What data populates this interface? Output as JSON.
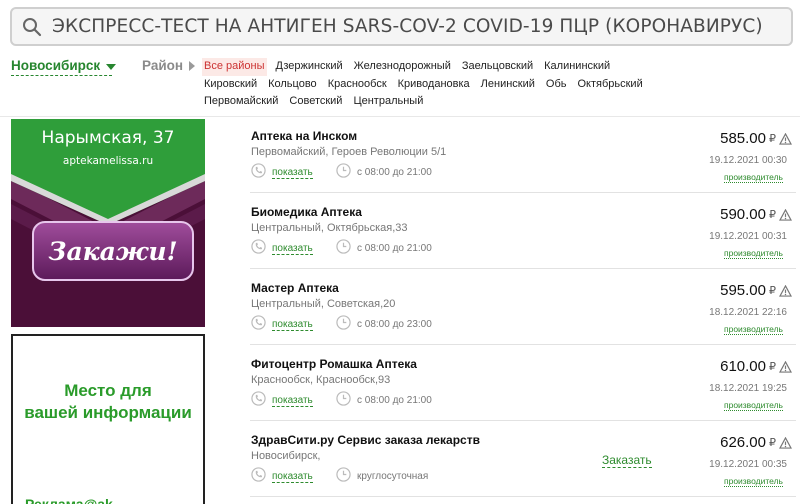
{
  "search": {
    "query": "ЭКСПРЕСС-ТЕСТ НА АНТИГЕН SARS-COV-2 COVID-19 ПЦР (КОРОНАВИРУС)",
    "icon": "search-icon"
  },
  "filters": {
    "city": "Новосибирск",
    "district_label": "Район",
    "districts": [
      "Все районы",
      "Дзержинский",
      "Железнодорожный",
      "Заельцовский",
      "Калининский",
      "Кировский",
      "Кольцово",
      "Краснообск",
      "Криводановка",
      "Ленинский",
      "Обь",
      "Октябрьский",
      "Первомайский",
      "Советский",
      "Центральный"
    ],
    "active_district": "Все районы"
  },
  "banners": {
    "pharmacy_ad": {
      "street": "Нарымская, 37",
      "site": "aptekamelissa.ru",
      "cta": "Закажи!"
    },
    "placeholder_ad": {
      "line1": "Место для",
      "line2": "вашей информации",
      "tail": "Реклама@ak"
    }
  },
  "listing": {
    "phone_label": "показать",
    "manufacturer_label": "производитель",
    "currency": "₽",
    "order_label": "Заказать",
    "items": [
      {
        "name": "Аптека на Инском",
        "address": "Первомайский, Героев Революции 5/1",
        "hours": "с 08:00 до 21:00",
        "price": "585.00",
        "date": "19.12.2021 00:30"
      },
      {
        "name": "Биомедика Аптека",
        "address": "Центральный, Октябрьская,33",
        "hours": "с 08:00 до 21:00",
        "price": "590.00",
        "date": "19.12.2021 00:31"
      },
      {
        "name": "Мастер Аптека",
        "address": "Центральный, Советская,20",
        "hours": "с 08:00 до 23:00",
        "price": "595.00",
        "date": "18.12.2021 22:16"
      },
      {
        "name": "Фитоцентр Ромашка Аптека",
        "address": "Краснообск, Краснообск,93",
        "hours": "с 08:00 до 21:00",
        "price": "610.00",
        "date": "18.12.2021 19:25"
      },
      {
        "name": "ЗдравСити.ру Сервис заказа лекарств",
        "address": "Новосибирск,",
        "hours": "круглосуточная",
        "price": "626.00",
        "date": "19.12.2021 00:35",
        "has_order": true
      }
    ]
  },
  "colors": {
    "accent": "#27862f",
    "active_district_bg": "#fce9e6",
    "active_district_text": "#cc3333"
  }
}
